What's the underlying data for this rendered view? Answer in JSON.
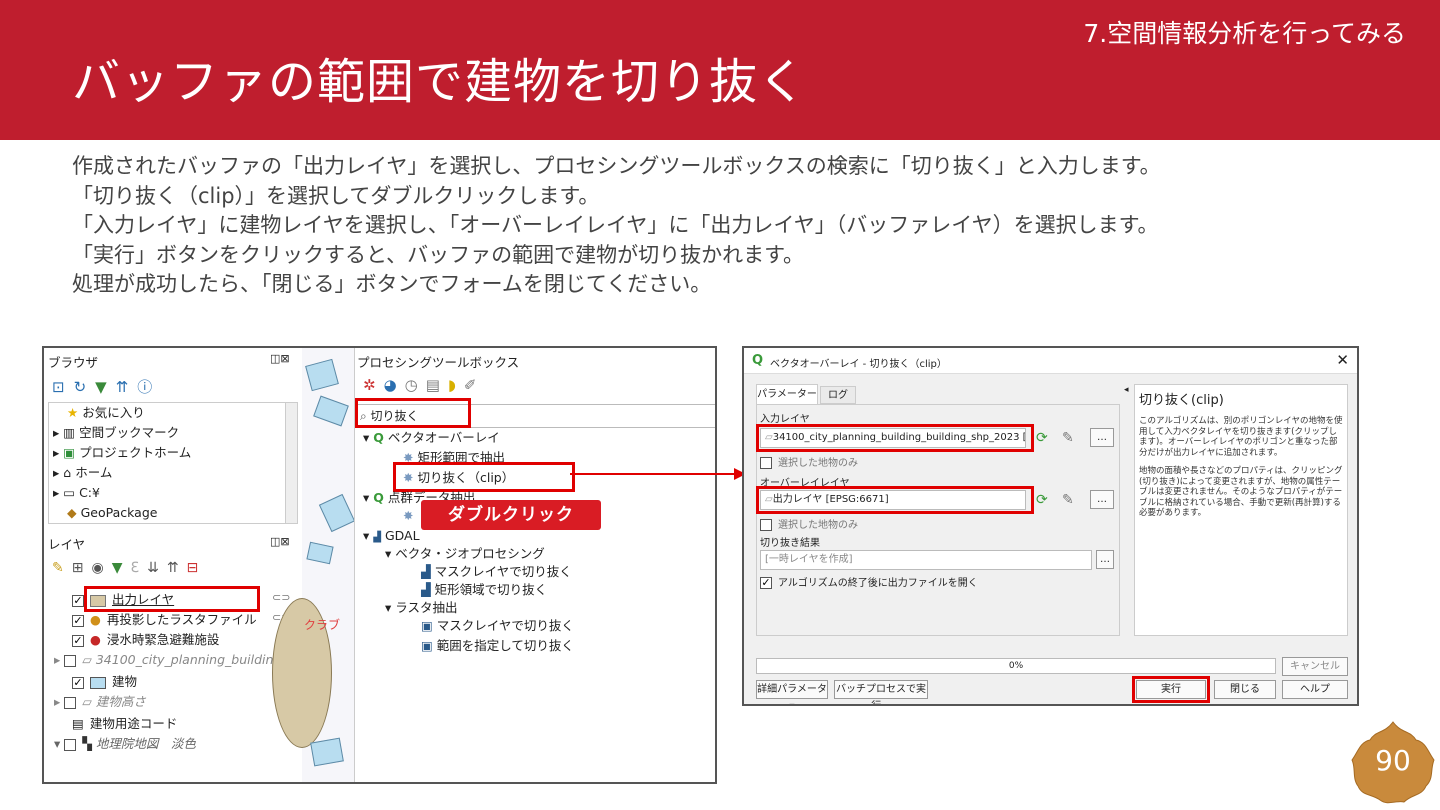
{
  "header": {
    "chapter": "7.空間情報分析を行ってみる",
    "title": "バッファの範囲で建物を切り抜く"
  },
  "body": {
    "lines": [
      "作成されたバッファの「出力レイヤ」を選択し、プロセシングツールボックスの検索に「切り抜く」と入力します。",
      "「切り抜く（clip）」を選択してダブルクリックします。",
      "「入力レイヤ」に建物レイヤを選択し、「オーバーレイレイヤ」に「出力レイヤ」（バッファレイヤ）を選択します。",
      "「実行」ボタンをクリックすると、バッファの範囲で建物が切り抜かれます。",
      "処理が成功したら、「閉じる」ボタンでフォームを閉じてください。"
    ]
  },
  "browser_panel": {
    "title": "ブラウザ",
    "items": [
      "お気に入り",
      "空間ブックマーク",
      "プロジェクトホーム",
      "ホーム",
      "C:¥",
      "GeoPackage"
    ]
  },
  "layers_panel": {
    "title": "レイヤ",
    "items": [
      "出力レイヤ",
      "再投影したラスタファイル",
      "浸水時緊急避難施設",
      "34100_city_planning_building_",
      "建物",
      "建物高さ",
      "建物用途コード",
      "地理院地図　淡色"
    ]
  },
  "map_label": "クラブ",
  "toolbox": {
    "title": "プロセシングツールボックス",
    "search_value": "切り抜く",
    "items": [
      "ベクタオーバーレイ",
      "矩形範囲で抽出",
      "切り抜く（clip）",
      "点群データ抽出",
      "GDAL",
      "ベクタ・ジオプロセシング",
      "マスクレイヤで切り抜く",
      "矩形領域で切り抜く",
      "ラスタ抽出",
      "マスクレイヤで切り抜く",
      "範囲を指定して切り抜く"
    ]
  },
  "callout": "ダブルクリック",
  "dialog": {
    "title": "ベクタオーバーレイ - 切り抜く（clip）",
    "tabs": [
      "パラメーター",
      "ログ"
    ],
    "input_layer_label": "入力レイヤ",
    "input_layer_value": "34100_city_planning_building_building_shp_2023 [EPSG",
    "selected_only": "選択した地物のみ",
    "overlay_label": "オーバーレイレイヤ",
    "overlay_value": "出力レイヤ [EPSG:6671]",
    "result_label": "切り抜き結果",
    "result_placeholder": "[一時レイヤを作成]",
    "open_output": "アルゴリズムの終了後に出力ファイルを開く",
    "help_title": "切り抜く(clip)",
    "help_p1": "このアルゴリズムは、別のポリゴンレイヤの地物を使用して入力ベクタレイヤを切り抜きます(クリップします)。オーバーレイレイヤのポリゴンと重なった部分だけが出力レイヤに追加されます。",
    "help_p2": "地物の面積や長さなどのプロパティは、クリッピング(切り抜き)によって変更されますが、地物の属性テーブルは変更されません。そのようなプロパティがテーブルに格納されている場合、手動で更新(再計算)する必要があります。",
    "progress": "0%",
    "cancel": "キャンセル",
    "advanced": "詳細パラメータ",
    "batch": "バッチプロセスで実行...",
    "run": "実行",
    "close": "閉じる",
    "help": "ヘルプ"
  },
  "page_number": "90",
  "colors": {
    "header": "#bf1e2e",
    "highlight": "#e00000",
    "badge": "#c98a3c"
  }
}
